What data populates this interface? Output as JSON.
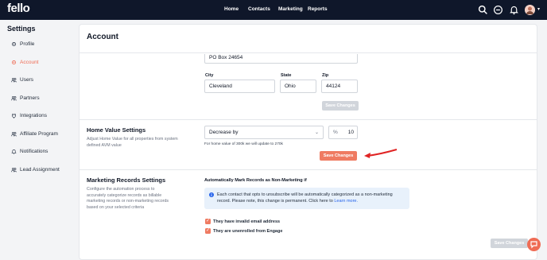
{
  "brand": {
    "logo": "fello",
    "accent": "#ef6c55",
    "topbar_bg": "#0f172a"
  },
  "nav": {
    "items": [
      {
        "label": "Home"
      },
      {
        "label": "Contacts"
      },
      {
        "label": "Marketing"
      },
      {
        "label": "Reports"
      }
    ],
    "icons": [
      "search-icon",
      "plus-circle-icon",
      "bell-icon",
      "avatar",
      "chevron-down-icon"
    ]
  },
  "sidebar": {
    "title": "Settings",
    "items": [
      {
        "label": "Profile",
        "icon": "gear-icon"
      },
      {
        "label": "Account",
        "icon": "gear-icon"
      },
      {
        "label": "Users",
        "icon": "users-icon"
      },
      {
        "label": "Partners",
        "icon": "users-icon"
      },
      {
        "label": "Integrations",
        "icon": "plug-icon"
      },
      {
        "label": "Affiliate Program",
        "icon": "users-icon"
      },
      {
        "label": "Notifications",
        "icon": "bell-icon"
      },
      {
        "label": "Lead Assignment",
        "icon": "users-icon"
      }
    ],
    "active": "Account"
  },
  "main": {
    "title": "Account",
    "address": {
      "street_value": "PO Box 24654",
      "city_label": "City",
      "city_value": "Cleveland",
      "state_label": "State",
      "state_value": "Ohio",
      "zip_label": "Zip",
      "zip_value": "44124",
      "save_label": "Save Changes"
    },
    "home_value": {
      "title": "Home Value Settings",
      "description": "Adjust Home Value for all properties from system defined AVM value",
      "mode_value": "Decrease by",
      "unit": "%",
      "amount_value": "10",
      "hint": "For home value of 300k we will update to 270k",
      "save_label": "Save Changes"
    },
    "marketing": {
      "title": "Marketing Records Settings",
      "description": "Configure the automation process to accurately categorize records as billable marketing records or non-marketing records based on your selected criteria",
      "auto_mark_label": "Automatically Mark Records as Non-Marketing if",
      "info_text": "Each contact that opts to unsubscribe will be automatically categorized as a non-marketing record. Please note, this change is permanent. Click here to",
      "info_link": "Learn more.",
      "checkbox_1": "They have invalid email address",
      "checkbox_2": "They are unenrolled from Engage",
      "save_label": "Save Changes"
    }
  }
}
